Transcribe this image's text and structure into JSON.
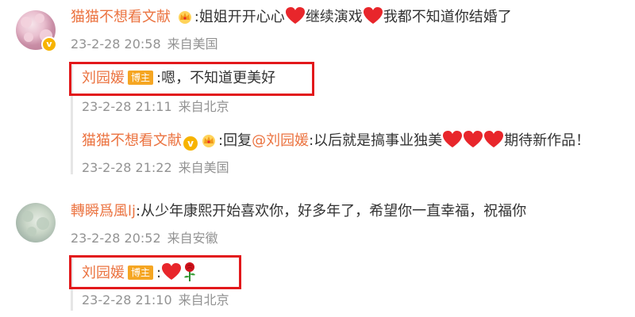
{
  "comment1": {
    "username": "猫猫不想看文献",
    "separator": ":",
    "text_a": "姐姐开开心心",
    "text_b": "继续演戏",
    "text_c": "我都不知道你结婚了",
    "time": "23-2-28 20:58",
    "location": "来自美国"
  },
  "reply1": {
    "username": "刘园媛",
    "badge": "博主",
    "text": ":嗯，不知道更美好",
    "time": "23-2-28 21:11",
    "location": "来自北京"
  },
  "reply2": {
    "username": "猫猫不想看文献",
    "prefix": ":回复",
    "mention": "@刘园媛",
    "text": ":以后就是搞事业独美",
    "text_end": "期待新作品！",
    "time": "23-2-28 21:22",
    "location": "来自美国"
  },
  "comment2": {
    "username": "轉瞬爲風lj",
    "text": ":从少年康熙开始喜欢你，好多年了，希望你一直幸福，祝福你",
    "time": "23-2-28 20:52",
    "location": "来自安徽"
  },
  "reply3": {
    "username": "刘园媛",
    "badge": "博主",
    "separator": ":",
    "time": "23-2-28 21:10",
    "location": "来自北京"
  },
  "colors": {
    "username": "#eb7340",
    "highlight": "#e2181b",
    "badge": "#f5a623",
    "heart": "#e8262b",
    "meta": "#939393"
  },
  "icons": {
    "crown": "crown-icon",
    "heart": "heart-icon",
    "rose": "rose-icon",
    "verified": "verified-v-icon"
  }
}
